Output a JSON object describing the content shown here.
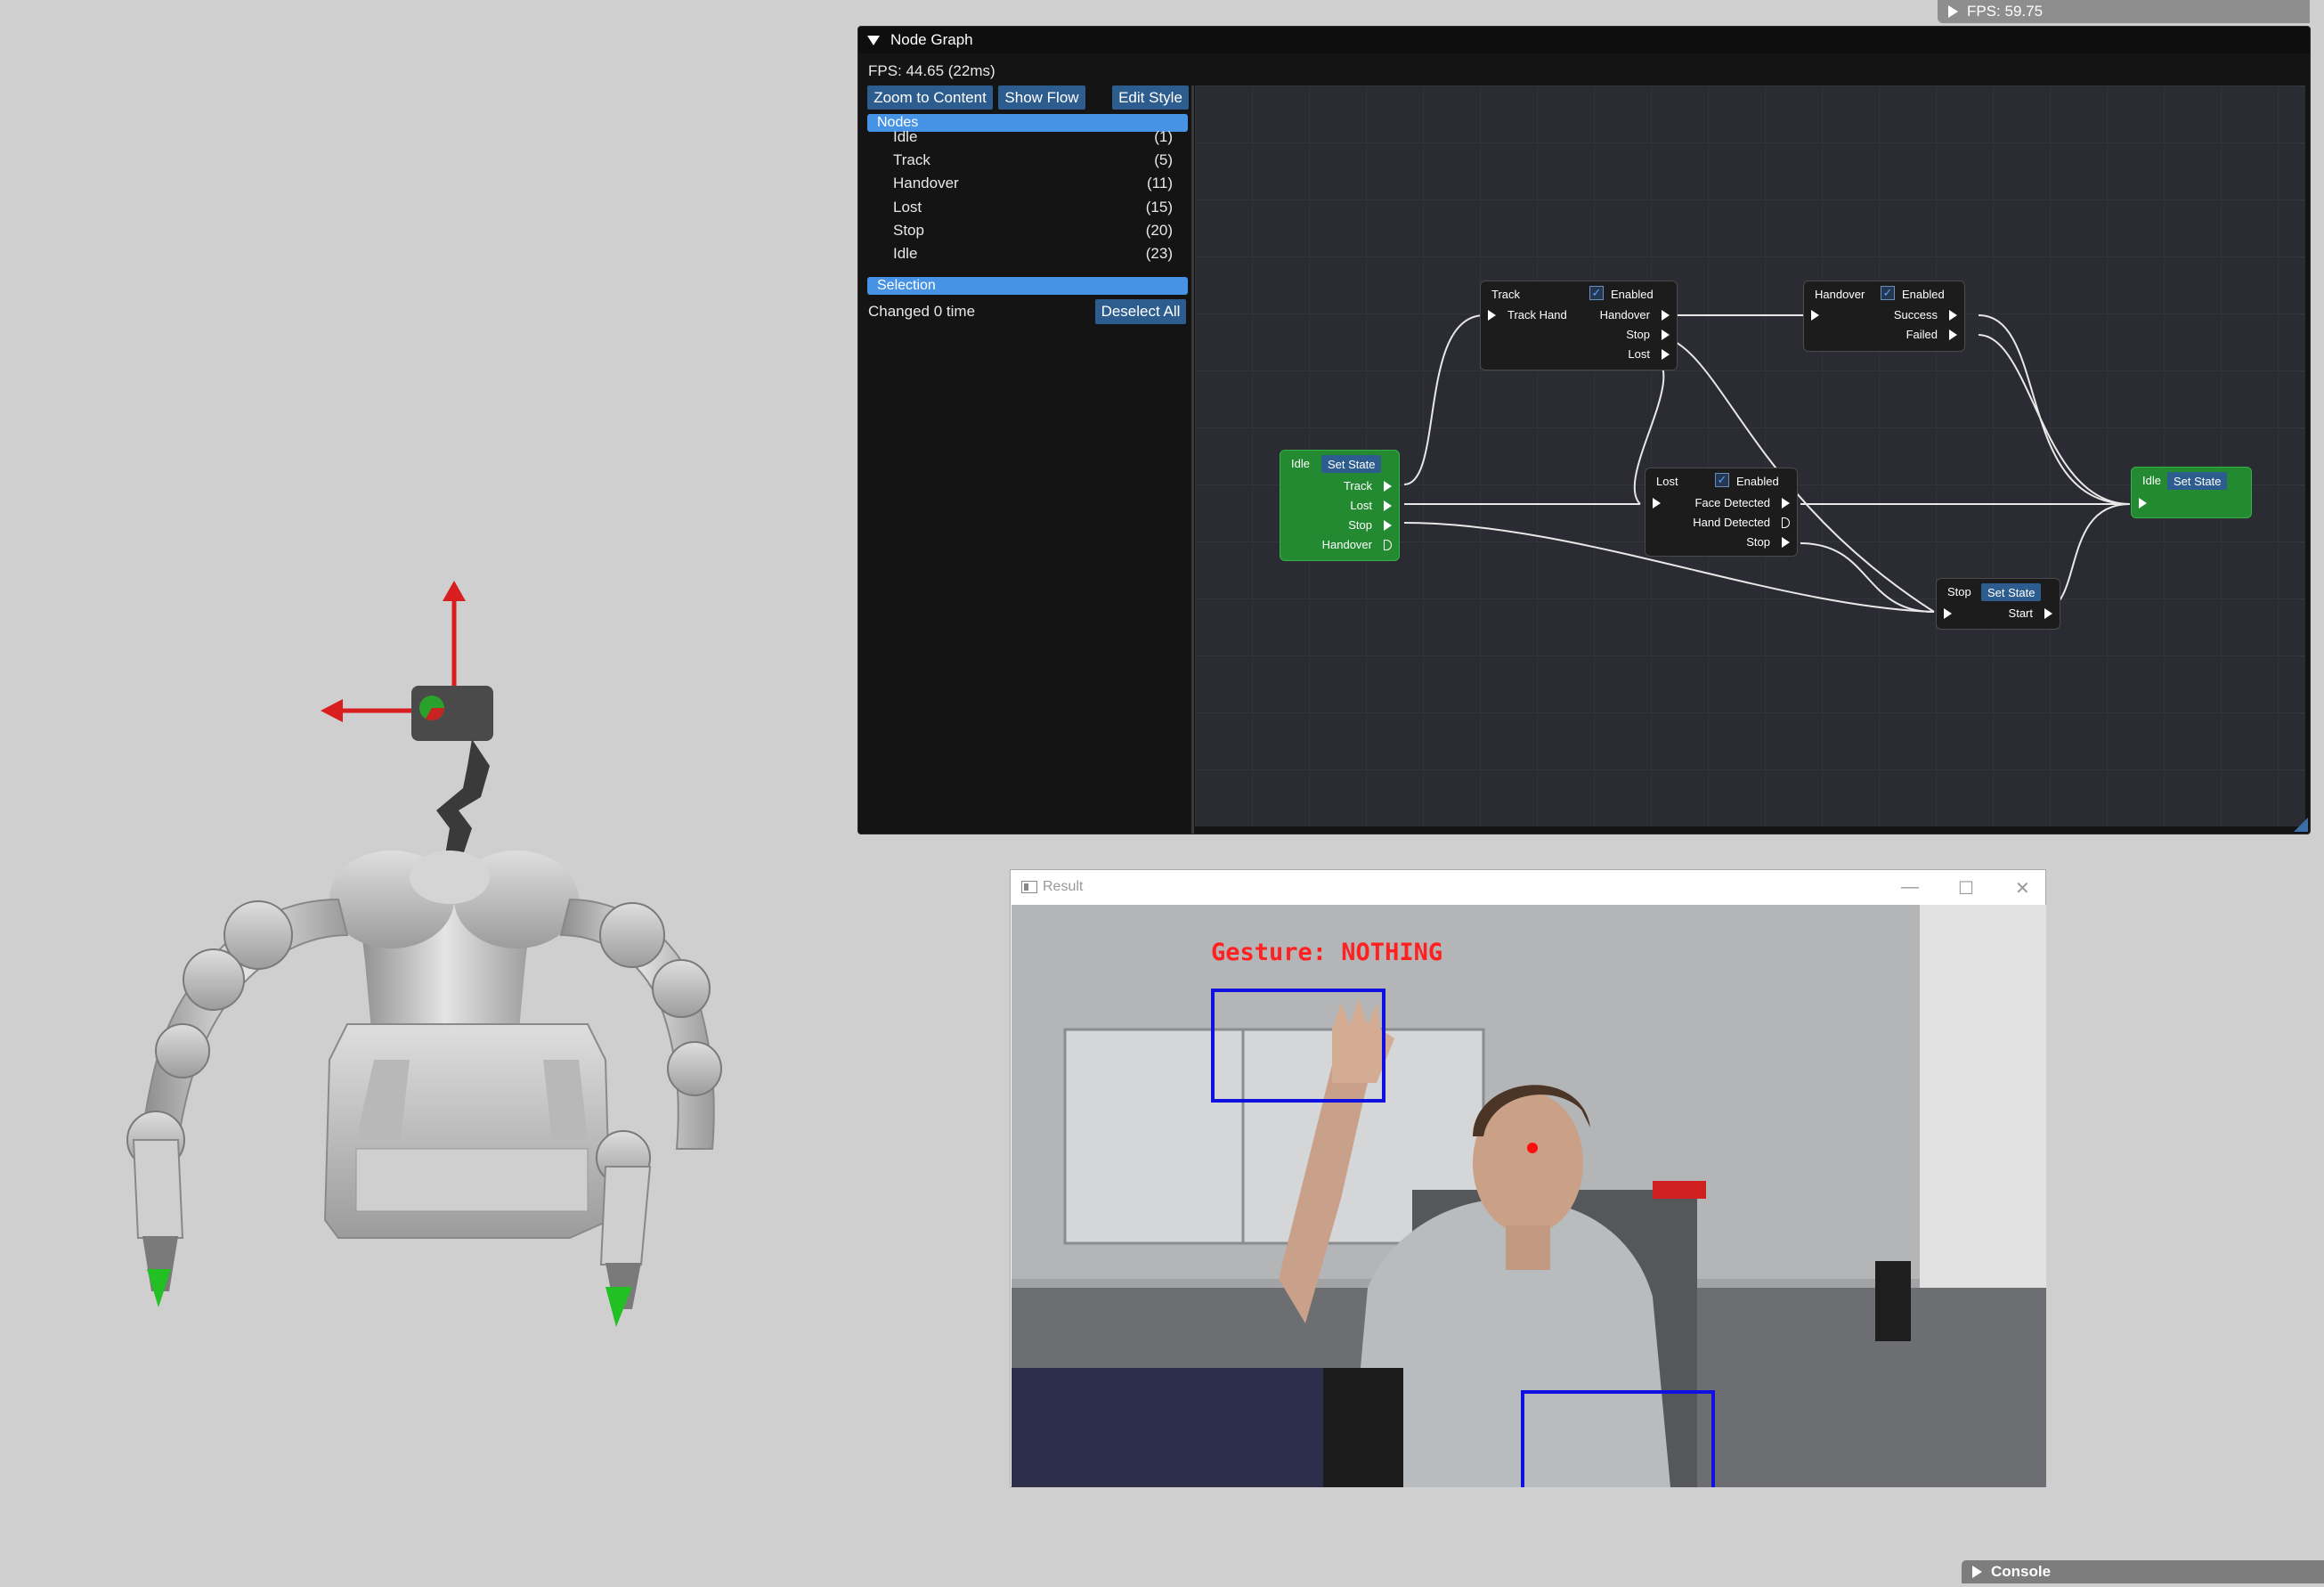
{
  "overlay": {
    "fps_text": "FPS: 59.75"
  },
  "node_graph": {
    "window_title": "Node Graph",
    "fps_text": "FPS: 44.65 (22ms)",
    "buttons": {
      "zoom": "Zoom to Content",
      "flow": "Show Flow",
      "style": "Edit Style"
    },
    "nodes_header": "Nodes",
    "node_list": [
      {
        "name": "Idle",
        "id": "(1)"
      },
      {
        "name": "Track",
        "id": "(5)"
      },
      {
        "name": "Handover",
        "id": "(11)"
      },
      {
        "name": "Lost",
        "id": "(15)"
      },
      {
        "name": "Stop",
        "id": "(20)"
      },
      {
        "name": "Idle",
        "id": "(23)"
      }
    ],
    "selection_header": "Selection",
    "changed_text": "Changed 0 time",
    "deselect_label": "Deselect All",
    "graph": {
      "idle1": {
        "title": "Idle",
        "button": "Set State",
        "outputs": [
          "Track",
          "Lost",
          "Stop",
          "Handover"
        ]
      },
      "track": {
        "title": "Track",
        "enabled": "Enabled",
        "input": "Track Hand",
        "outputs": [
          "Handover",
          "Stop",
          "Lost"
        ]
      },
      "handover": {
        "title": "Handover",
        "enabled": "Enabled",
        "outputs": [
          "Success",
          "Failed"
        ]
      },
      "lost": {
        "title": "Lost",
        "enabled": "Enabled",
        "outputs": [
          "Face Detected",
          "Hand Detected",
          "Stop"
        ]
      },
      "stop": {
        "title": "Stop",
        "button": "Set State",
        "output": "Start"
      },
      "idle2": {
        "title": "Idle",
        "button": "Set State"
      }
    }
  },
  "result_window": {
    "title": "Result",
    "gesture_text": "Gesture: NOTHING",
    "colors": {
      "box": "#1010e0",
      "gesture": "#ff2020"
    }
  },
  "console": {
    "label": "Console"
  }
}
